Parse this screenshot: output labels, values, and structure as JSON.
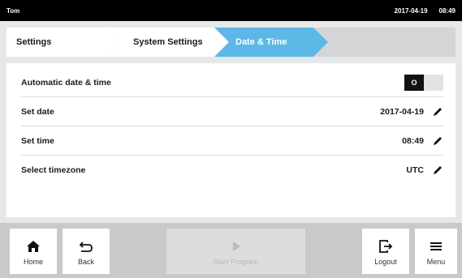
{
  "status": {
    "user": "Tom",
    "date": "2017-04-19",
    "time": "08:49"
  },
  "breadcrumbs": [
    "Settings",
    "System Settings",
    "Date & Time"
  ],
  "rows": {
    "automatic": {
      "label": "Automatic date & time",
      "toggle_state": "O"
    },
    "date": {
      "label": "Set date",
      "value": "2017-04-19"
    },
    "time": {
      "label": "Set time",
      "value": "08:49"
    },
    "timezone": {
      "label": "Select timezone",
      "value": "UTC"
    }
  },
  "toolbar": {
    "home": "Home",
    "back": "Back",
    "start": "Start Program",
    "logout": "Logout",
    "menu": "Menu"
  },
  "colors": {
    "accent": "#5cb8e6",
    "statusbar": "#000000",
    "background": "#e6e7e8"
  }
}
